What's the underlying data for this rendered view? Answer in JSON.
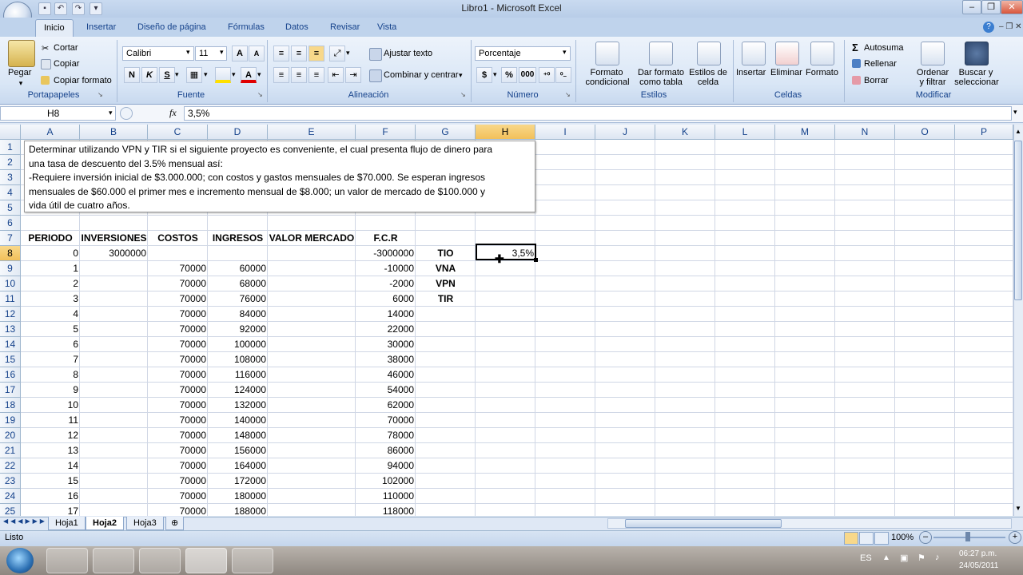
{
  "window": {
    "title": "Libro1 - Microsoft Excel"
  },
  "ribbon": {
    "tabs": [
      "Inicio",
      "Insertar",
      "Diseño de página",
      "Fórmulas",
      "Datos",
      "Revisar",
      "Vista"
    ],
    "clipboard": {
      "paste": "Pegar",
      "cut": "Cortar",
      "copy": "Copiar",
      "format_painter": "Copiar formato",
      "label": "Portapapeles"
    },
    "font": {
      "name": "Calibri",
      "size": "11",
      "bold": "N",
      "italic": "K",
      "underline": "S",
      "label": "Fuente"
    },
    "alignment": {
      "wrap": "Ajustar texto",
      "merge": "Combinar y centrar",
      "label": "Alineación"
    },
    "number": {
      "format": "Porcentaje",
      "currency": "$",
      "percent": "%",
      "thousands": "000",
      "label": "Número"
    },
    "styles": {
      "conditional_1": "Formato",
      "conditional_2": "condicional",
      "table_1": "Dar formato",
      "table_2": "como tabla",
      "cell_1": "Estilos de",
      "cell_2": "celda",
      "label": "Estilos"
    },
    "cells": {
      "insert": "Insertar",
      "delete": "Eliminar",
      "format": "Formato",
      "label": "Celdas"
    },
    "editing": {
      "autosum": "Autosuma",
      "fill": "Rellenar",
      "clear": "Borrar",
      "sort_1": "Ordenar",
      "sort_2": "y filtrar",
      "find_1": "Buscar y",
      "find_2": "seleccionar",
      "label": "Modificar"
    }
  },
  "formula_bar": {
    "name_box": "H8",
    "fx": "fx",
    "value": "3,5%"
  },
  "columns": [
    "A",
    "B",
    "C",
    "D",
    "E",
    "F",
    "G",
    "H",
    "I",
    "J",
    "K",
    "L",
    "M",
    "N",
    "O",
    "P"
  ],
  "rows": [
    "1",
    "2",
    "3",
    "4",
    "5",
    "6",
    "7",
    "8",
    "9",
    "10",
    "11",
    "12",
    "13",
    "14",
    "15",
    "16",
    "17",
    "18",
    "19",
    "20",
    "21",
    "22",
    "23",
    "24",
    "25"
  ],
  "textbox": {
    "line1": "Determinar utilizando VPN y TIR si el siguiente proyecto es conveniente, el cual presenta  flujo de dinero para",
    "line2": "una tasa de descuento del 3.5% mensual así:",
    "line3": "-Requiere inversión inicial de $3.000.000;  con costos y gastos mensuales de $70.000.  Se esperan ingresos",
    "line4": "mensuales de $60.000 el primer mes e incremento mensual de $8.000;  un valor de mercado de $100.000  y",
    "line5": "vida útil de cuatro años."
  },
  "table": {
    "headers": {
      "periodo": "PERIODO",
      "inversiones": "INVERSIONES",
      "costos": "COSTOS",
      "ingresos": "INGRESOS",
      "valor_mercado": "VALOR MERCADO",
      "fcr": "F.C.R"
    },
    "periodo": [
      "0",
      "1",
      "2",
      "3",
      "4",
      "5",
      "6",
      "7",
      "8",
      "9",
      "10",
      "11",
      "12",
      "13",
      "14",
      "15",
      "16",
      "17"
    ],
    "inversiones": [
      "3000000",
      "",
      "",
      "",
      "",
      "",
      "",
      "",
      "",
      "",
      "",
      "",
      "",
      "",
      "",
      "",
      "",
      ""
    ],
    "costos": [
      "",
      "70000",
      "70000",
      "70000",
      "70000",
      "70000",
      "70000",
      "70000",
      "70000",
      "70000",
      "70000",
      "70000",
      "70000",
      "70000",
      "70000",
      "70000",
      "70000",
      "70000"
    ],
    "ingresos": [
      "",
      "60000",
      "68000",
      "76000",
      "84000",
      "92000",
      "100000",
      "108000",
      "116000",
      "124000",
      "132000",
      "140000",
      "148000",
      "156000",
      "164000",
      "172000",
      "180000",
      "188000"
    ],
    "fcr": [
      "-3000000",
      "-10000",
      "-2000",
      "6000",
      "14000",
      "22000",
      "30000",
      "38000",
      "46000",
      "54000",
      "62000",
      "70000",
      "78000",
      "86000",
      "94000",
      "102000",
      "110000",
      "118000"
    ]
  },
  "indicators": {
    "tio": "TIO",
    "vna": "VNA",
    "vpn": "VPN",
    "tir": "TIR",
    "tio_value": "3,5%"
  },
  "sheets": [
    "Hoja1",
    "Hoja2",
    "Hoja3"
  ],
  "status": {
    "ready": "Listo",
    "zoom": "100%"
  },
  "taskbar": {
    "lang": "ES",
    "time": "06:27 p.m.",
    "date": "24/05/2011"
  }
}
